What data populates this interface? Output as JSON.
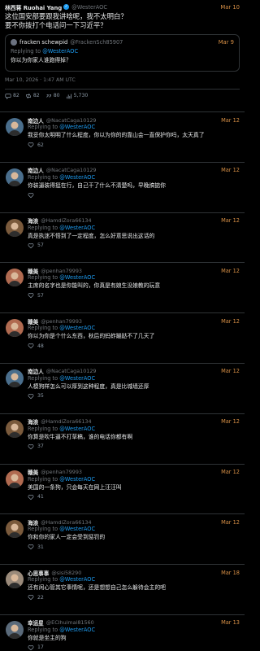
{
  "main_tweet": {
    "display_name": "林西蒋 Ruohai Yang",
    "handle": "@WesterAOC",
    "date": "Mar 10",
    "text_line1": "这位国安部要跟我讲啥呢，我不太明白？",
    "text_line2": "要不你拨打个电话问一下习近平？",
    "quote": {
      "display_name": "fracken schewpid",
      "handle": "@FrackenSch85907",
      "date": "Mar 9",
      "reply_prefix": "Replying to",
      "reply_handle": "@WesterAOC",
      "text": "你以为你家人谁跑得掉？"
    },
    "timestamp": "Mar 10, 2026 · 1:47 AM UTC",
    "stats": {
      "comments": "82",
      "retweets": "82",
      "likes": "80",
      "views": "5,730"
    }
  },
  "replies": [
    {
      "name": "南边人",
      "handle": "@NacatCaga10129",
      "date": "Mar 12",
      "reply_prefix": "Replying to",
      "reply_handle": "@WesterAOC",
      "text": "我妥你太明明了什么程度，你以为你的的靠山会一直保护你吗，太天真了",
      "likes": "62",
      "avatar_color": "#4a6e8c"
    },
    {
      "name": "南边人",
      "handle": "@NacatCaga10129",
      "date": "Mar 12",
      "reply_prefix": "Replying to",
      "reply_handle": "@WesterAOC",
      "text": "你装逼装得挺在行，自己干了什么不清楚吗，早晚搞掂你",
      "likes": "",
      "avatar_color": "#4a6e8c"
    },
    {
      "name": "海浪",
      "handle": "@HamdiZora66134",
      "date": "Mar 12",
      "reply_prefix": "Replying to",
      "reply_handle": "@WesterAOC",
      "text": "真是执迷不悟到了一定程度，怎么好意思说出这话的",
      "likes": "57",
      "avatar_color": "#7a5a3c"
    },
    {
      "name": "赣美",
      "handle": "@penhan79993",
      "date": "Mar 12",
      "reply_prefix": "Replying to",
      "reply_handle": "@WesterAOC",
      "text": "主席的名字也是你能叫的，你真是有娘生没娘教的玩意",
      "likes": "57",
      "avatar_color": "#b06a50"
    },
    {
      "name": "赣美",
      "handle": "@penhan79993",
      "date": "Mar 12",
      "reply_prefix": "Replying to",
      "reply_handle": "@WesterAOC",
      "text": "你以为你是个什么东西，秋后的蚂蚱蹦跶不了几天了",
      "likes": "48",
      "avatar_color": "#b06a50"
    },
    {
      "name": "南边人",
      "handle": "@NacatCaga10129",
      "date": "Mar 12",
      "reply_prefix": "Replying to",
      "reply_handle": "@WesterAOC",
      "text": "人模狗样怎么可以厚到这种程度，真是比城墙还厚",
      "likes": "35",
      "avatar_color": "#4a6e8c"
    },
    {
      "name": "海浪",
      "handle": "@HamdiZora66134",
      "date": "Mar 12",
      "reply_prefix": "Replying to",
      "reply_handle": "@WesterAOC",
      "text": "你算是吹牛逼不打草稿，谁的电话你都有啊",
      "likes": "37",
      "avatar_color": "#7a5a3c"
    },
    {
      "name": "赣美",
      "handle": "@penhan79993",
      "date": "Mar 12",
      "reply_prefix": "Replying to",
      "reply_handle": "@WesterAOC",
      "text": "美国的一条狗，只会每天在网上汪汪叫",
      "likes": "41",
      "avatar_color": "#b06a50"
    },
    {
      "name": "海浪",
      "handle": "@HamdiZora66134",
      "date": "Mar 12",
      "reply_prefix": "Replying to",
      "reply_handle": "@WesterAOC",
      "text": "你和你的家人一定会受到惩罚的",
      "likes": "31",
      "avatar_color": "#7a5a3c"
    },
    {
      "name": "心思事事",
      "handle": "@sisi58290",
      "date": "Mar 18",
      "reply_prefix": "Replying to",
      "reply_handle": "@WesterAOC",
      "text": "还有闲心管其它事情呢，还是想想自己怎么躲待会主的吧",
      "likes": "22",
      "avatar_color": "#9a8a7a"
    },
    {
      "name": "幸运星",
      "handle": "@ECIhuimai81560",
      "date": "Mar 13",
      "reply_prefix": "Replying to",
      "reply_handle": "@WesterAOC",
      "text": "你就是坐主的狗",
      "likes": "17",
      "avatar_color": "#5a6a7a"
    }
  ]
}
